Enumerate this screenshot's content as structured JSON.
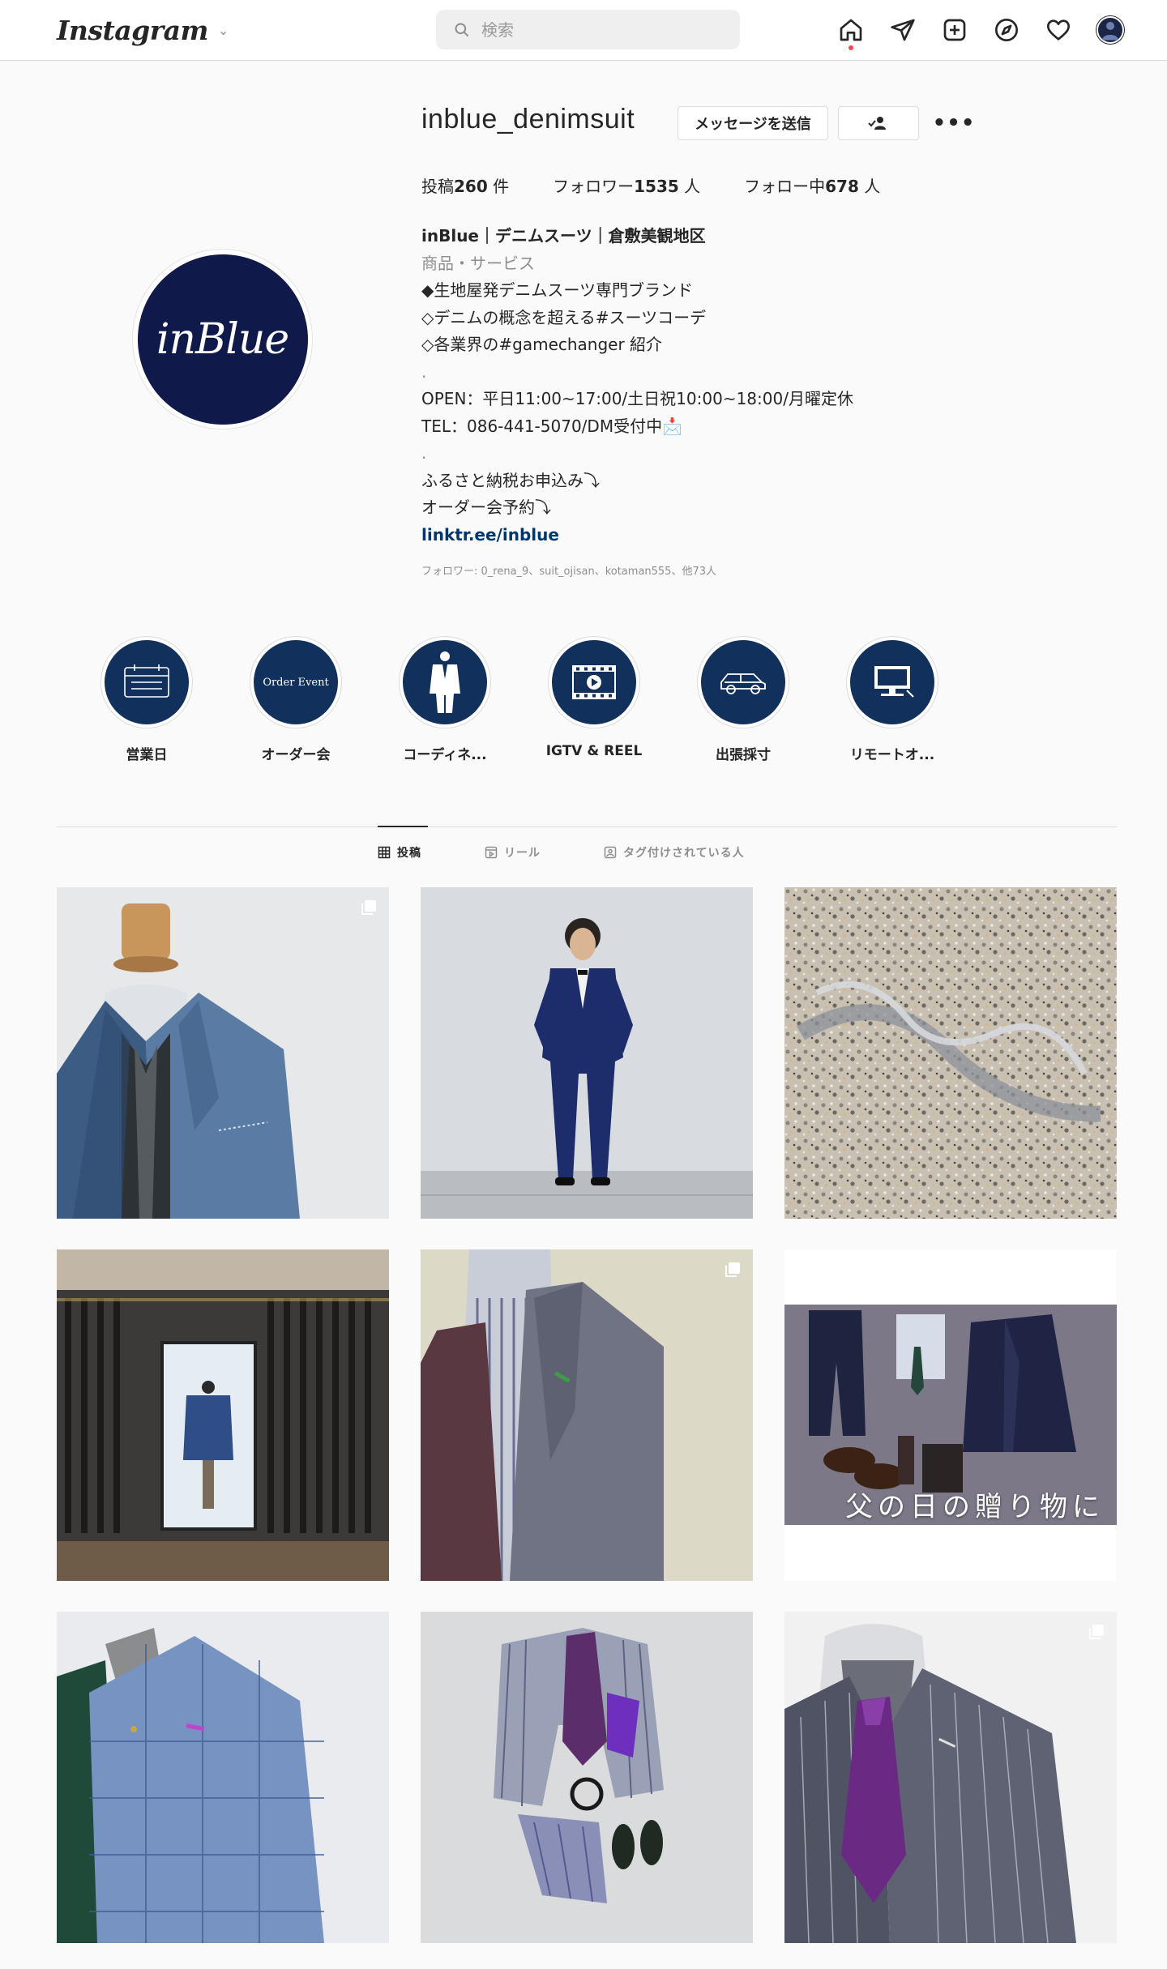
{
  "header": {
    "logo": "Instagram",
    "search_placeholder": "検索",
    "nav_icons": [
      "home-icon",
      "direct-icon",
      "new-post-icon",
      "explore-icon",
      "activity-heart-icon",
      "profile-avatar"
    ]
  },
  "profile": {
    "username": "inblue_denimsuit",
    "message_button": "メッセージを送信",
    "avatar_text": "inBlue",
    "stats": {
      "posts_label": "投稿",
      "posts": "260",
      "posts_unit": "件",
      "followers_label": "フォロワー",
      "followers": "1535",
      "followers_unit": "人",
      "following_label": "フォロー中",
      "following": "678",
      "following_unit": "人"
    },
    "bio": {
      "name": "inBlue｜デニムスーツ｜倉敷美観地区",
      "category": "商品・サービス",
      "lines": [
        "◆生地屋発デニムスーツ専門ブランド",
        "◇デニムの概念を超える#スーツコーデ",
        "◇各業界の#gamechanger 紹介",
        ".",
        "OPEN：平日11:00~17:00/土日祝10:00~18:00/月曜定休",
        "TEL：086-441-5070/DM受付中📩",
        ".",
        "ふるさと納税お申込み⤵︎",
        "オーダー会予約⤵︎"
      ],
      "link": "linktr.ee/inblue"
    },
    "followed_by": "フォロワー: 0_rena_9、suit_ojisan、kotaman555、他73人"
  },
  "highlights": [
    {
      "label": "営業日",
      "icon": "calendar-icon"
    },
    {
      "label": "オーダー会",
      "icon": "order-event-icon",
      "cover_text": "Order Event"
    },
    {
      "label": "コーディネ...",
      "icon": "suit-figure-icon"
    },
    {
      "label": "IGTV & REEL",
      "icon": "film-icon"
    },
    {
      "label": "出張採寸",
      "icon": "car-icon"
    },
    {
      "label": "リモートオ...",
      "icon": "monitor-icon"
    }
  ],
  "tabs": [
    {
      "label": "投稿",
      "icon": "grid-icon",
      "active": true
    },
    {
      "label": "リール",
      "icon": "reels-icon",
      "active": false
    },
    {
      "label": "タグ付けされている人",
      "icon": "tagged-icon",
      "active": false
    }
  ],
  "posts": [
    {
      "subject": "mannequin-blue-denim-jacket",
      "multiple": true
    },
    {
      "subject": "man-in-navy-tuxedo",
      "multiple": false
    },
    {
      "subject": "inblue-logo-on-terrazzo",
      "multiple": false
    },
    {
      "subject": "shop-window-storefront",
      "multiple": false
    },
    {
      "subject": "grey-jacket-purple-tie",
      "multiple": true
    },
    {
      "subject": "fathers-day-flatlay",
      "multiple": false,
      "caption": "父の日の贈り物に"
    },
    {
      "subject": "checked-blue-jacket",
      "multiple": false
    },
    {
      "subject": "striped-jacket-flatlay",
      "multiple": false
    },
    {
      "subject": "pinstripe-suit-purple-tie",
      "multiple": true
    }
  ],
  "colors": {
    "brand_navy": "#0f1a4a",
    "highlight_bg": "#12305c",
    "link": "#00376b",
    "notification_dot": "#ed4956"
  }
}
